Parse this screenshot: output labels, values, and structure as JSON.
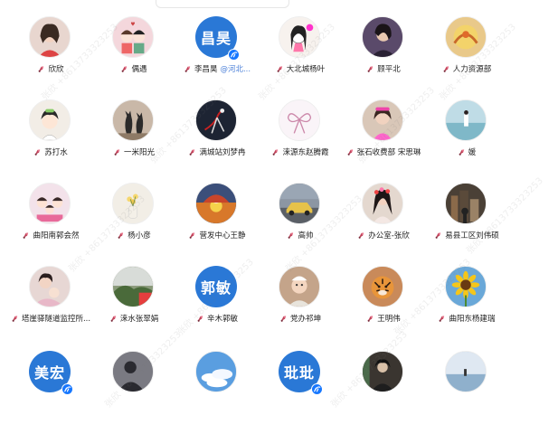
{
  "contacts": [
    {
      "name": "欣欣",
      "avatar": "woman-portrait-icon",
      "bg": "#e8d6cf"
    },
    {
      "name": "偶遇",
      "avatar": "cartoon-couple-icon",
      "bg": "#f4d7dc"
    },
    {
      "name": "李昌昊",
      "tag": "@河北...",
      "avatar_text": "昌昊",
      "bg": "#2a78d6",
      "verified": true
    },
    {
      "name": "大北城杨叶",
      "avatar": "cartoon-girl-icon",
      "bg": "#f7f2ee"
    },
    {
      "name": "顾平北",
      "avatar": "dark-portrait-icon",
      "bg": "#5a4a6a"
    },
    {
      "name": "人力资源部",
      "avatar": "gold-artwork-icon",
      "bg": "#e9c98a"
    },
    {
      "name": "苏打水",
      "avatar": "cartoon-kid-icon",
      "bg": "#f2ede6"
    },
    {
      "name": "一米阳光",
      "avatar": "cats-silhouette-icon",
      "bg": "#c9b8a8"
    },
    {
      "name": "满城站刘梦冉",
      "avatar": "dancer-icon",
      "bg": "#1d2433"
    },
    {
      "name": "涞源东赵腾霞",
      "avatar": "bow-ribbon-icon",
      "bg": "#faf4f8"
    },
    {
      "name": "张石收费部 宋思琳",
      "avatar": "girl-photo-icon",
      "bg": "#d9c7b8"
    },
    {
      "name": "媛",
      "avatar": "sea-figure-icon",
      "bg": "#bfdce6"
    },
    {
      "name": "曲阳南郭会然",
      "avatar": "family-cartoon-icon",
      "bg": "#f3e2ea"
    },
    {
      "name": "杨小彦",
      "avatar": "flower-vase-icon",
      "bg": "#f2eee6"
    },
    {
      "name": "营发中心王静",
      "avatar": "cartoon-autumn-icon",
      "bg": "#3b4f7a"
    },
    {
      "name": "高帅",
      "avatar": "car-icon",
      "bg": "#8c96a3"
    },
    {
      "name": "办公室-张欣",
      "avatar": "woman-flowers-icon",
      "bg": "#e4d8cf"
    },
    {
      "name": "易县工区刘伟硕",
      "avatar": "city-night-icon",
      "bg": "#4a4036"
    },
    {
      "name": "塔崖驿隧道监控所...",
      "avatar": "mother-child-icon",
      "bg": "#e7d7d4"
    },
    {
      "name": "涞水张翠娟",
      "avatar": "landscape-icon",
      "bg": "#8a9a7a"
    },
    {
      "name": "辛木郭敏",
      "avatar_text": "郭敏",
      "bg": "#2a78d6"
    },
    {
      "name": "党办祁坤",
      "avatar": "baby-photo-icon",
      "bg": "#c4a48a"
    },
    {
      "name": "王明伟",
      "avatar": "tiger-icon",
      "bg": "#c98a5a"
    },
    {
      "name": "曲阳东杨建瑞",
      "avatar": "sunflower-icon",
      "bg": "#6aa8d8"
    },
    {
      "name": "",
      "avatar_text": "美宏",
      "bg": "#2a78d6",
      "verified": true
    },
    {
      "name": "",
      "avatar": "silhouette-icon",
      "bg": "#7a7a82"
    },
    {
      "name": "",
      "avatar": "sky-clouds-icon",
      "bg": "#5a9ee0"
    },
    {
      "name": "",
      "avatar_text": "玭玭",
      "bg": "#2a78d6",
      "verified": true
    },
    {
      "name": "",
      "avatar": "dark-figure-icon",
      "bg": "#3a3530"
    },
    {
      "name": "",
      "avatar": "sea-horizon-icon",
      "bg": "#c7d8e8"
    }
  ],
  "watermark": "张欣 +8613733323253"
}
